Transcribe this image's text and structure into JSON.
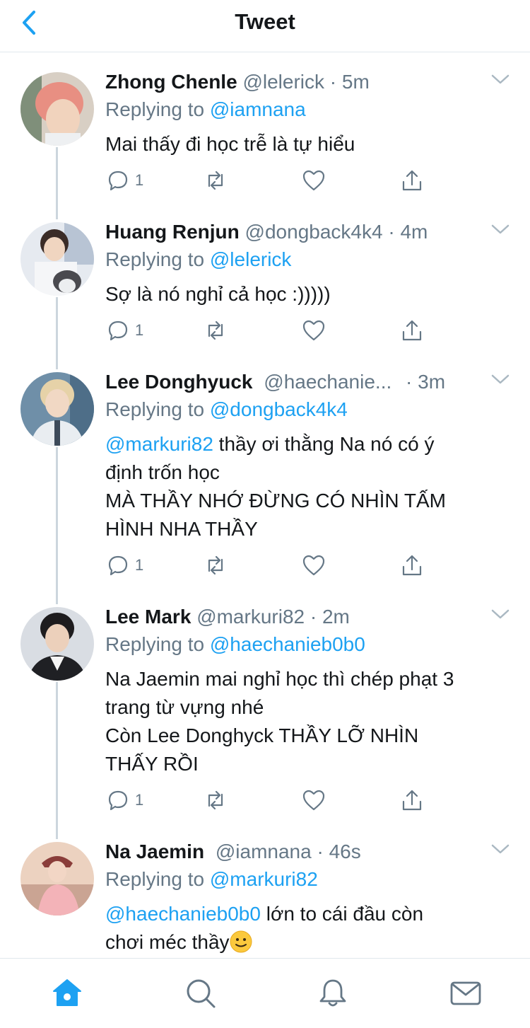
{
  "header": {
    "title": "Tweet"
  },
  "tweets": [
    {
      "name": "Zhong Chenle",
      "handle": "@lelerick",
      "dot": "·",
      "time": "5m",
      "replying_prefix": "Replying to",
      "replying_to": "@iamnana",
      "text_lines": [
        "Mai thấy đi học trễ là tự hiểu"
      ],
      "reply_count": "1"
    },
    {
      "name": "Huang Renjun",
      "handle": "@dongback4k4",
      "dot": "·",
      "time": "4m",
      "replying_prefix": "Replying to",
      "replying_to": "@lelerick",
      "text_lines": [
        "Sợ là nó nghỉ cả học :)))))"
      ],
      "reply_count": "1"
    },
    {
      "name": "Lee Donghyuck",
      "handle": "@haechanie...",
      "dot": "·",
      "time": "3m",
      "replying_prefix": "Replying to",
      "replying_to": "@dongback4k4",
      "mention": "@markuri82",
      "text_first_rest": " thầy ơi thằng Na nó có ý",
      "text_lines": [
        "định trốn học",
        "MÀ THẦY NHỚ ĐỪNG CÓ NHÌN TẤM",
        "HÌNH NHA THẦY"
      ],
      "reply_count": "1"
    },
    {
      "name": "Lee Mark",
      "handle": "@markuri82",
      "dot": "·",
      "time": "2m",
      "replying_prefix": "Replying to",
      "replying_to": "@haechanieb0b0",
      "text_lines": [
        "Na Jaemin mai nghỉ học thì chép phạt 3",
        "trang từ vựng nhé",
        "Còn Lee Donghyck THẦY LỠ NHÌN",
        "THẤY RỒI"
      ],
      "reply_count": "1"
    },
    {
      "name": "Na Jaemin",
      "handle": "@iamnana",
      "dot": "·",
      "time": "46s",
      "replying_prefix": "Replying to",
      "replying_to": "@markuri82",
      "mention": "@haechanieb0b0",
      "text_first_rest": " lớn to cái đầu còn",
      "text_lines": [
        "chơi méc thầy"
      ],
      "emoji": "slightly-smiling-face"
    }
  ],
  "icons": {
    "back": "chevron-left-icon",
    "caret": "chevron-down-icon",
    "reply": "reply-icon",
    "retweet": "retweet-icon",
    "like": "heart-icon",
    "share": "share-icon",
    "tabs": [
      "home-icon",
      "search-icon",
      "notifications-icon",
      "messages-icon"
    ]
  },
  "colors": {
    "accent": "#1da1f2",
    "text": "#14171a",
    "muted": "#657786",
    "divider": "#e1e8ed",
    "thread": "#ccd6dd"
  }
}
